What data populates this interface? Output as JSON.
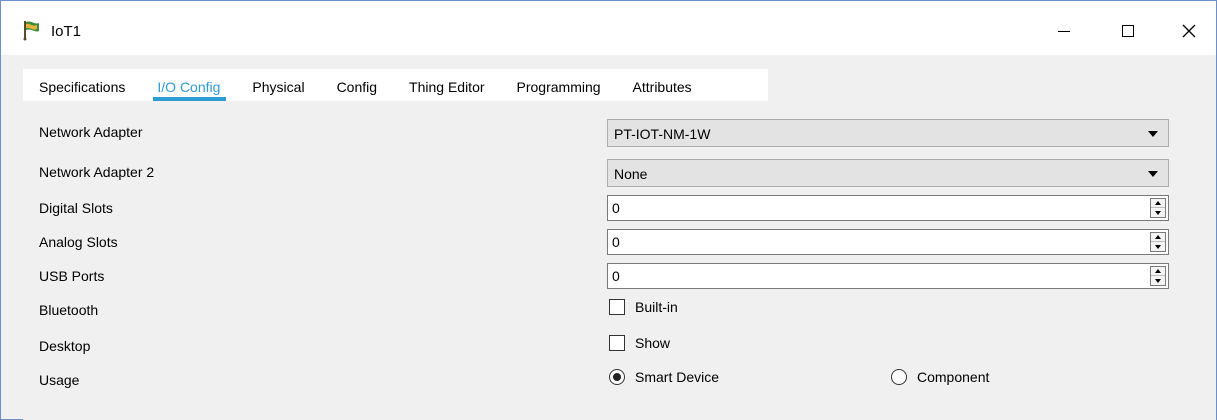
{
  "window": {
    "title": "IoT1",
    "minimize_glyph": "—",
    "close_glyph": "✕"
  },
  "tabs": [
    {
      "label": "Specifications",
      "active": false
    },
    {
      "label": "I/O Config",
      "active": true
    },
    {
      "label": "Physical",
      "active": false
    },
    {
      "label": "Config",
      "active": false
    },
    {
      "label": "Thing Editor",
      "active": false
    },
    {
      "label": "Programming",
      "active": false
    },
    {
      "label": "Attributes",
      "active": false
    }
  ],
  "colors": {
    "accent": "#2e9bd6",
    "window_border": "#6d8fc9",
    "panel_bg": "#f0f0f0",
    "select_bg": "#e3e3e3"
  },
  "form": {
    "network_adapter": {
      "label": "Network Adapter",
      "value": "PT-IOT-NM-1W"
    },
    "network_adapter_2": {
      "label": "Network Adapter 2",
      "value": "None"
    },
    "digital_slots": {
      "label": "Digital Slots",
      "value": "0"
    },
    "analog_slots": {
      "label": "Analog Slots",
      "value": "0"
    },
    "usb_ports": {
      "label": "USB Ports",
      "value": "0"
    },
    "bluetooth": {
      "label": "Bluetooth",
      "checkbox_label": "Built-in",
      "checked": false
    },
    "desktop": {
      "label": "Desktop",
      "checkbox_label": "Show",
      "checked": false
    },
    "usage": {
      "label": "Usage",
      "options": [
        {
          "label": "Smart Device",
          "selected": true
        },
        {
          "label": "Component",
          "selected": false
        }
      ]
    }
  },
  "icons": {
    "app": "iot-device-icon",
    "dropdown": "chevron-down-icon",
    "spin_up": "spin-up-icon",
    "spin_down": "spin-down-icon"
  }
}
